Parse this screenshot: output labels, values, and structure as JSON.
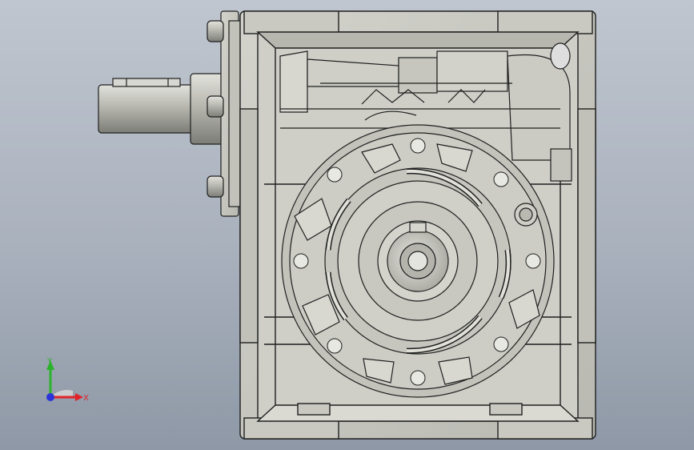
{
  "viewport": {
    "background_top": "#bfc6cf",
    "background_bottom": "#8e98a6"
  },
  "model": {
    "name": "worm-gear-reducer",
    "body_color": "#c7c7c0",
    "edge_color": "#1f1f1f",
    "shade_color": "#a3a39c"
  },
  "triad": {
    "x_label": "X",
    "y_label": "Y",
    "x_color": "#e0242a",
    "y_color": "#2bb32b",
    "z_color": "#2a34d8"
  }
}
